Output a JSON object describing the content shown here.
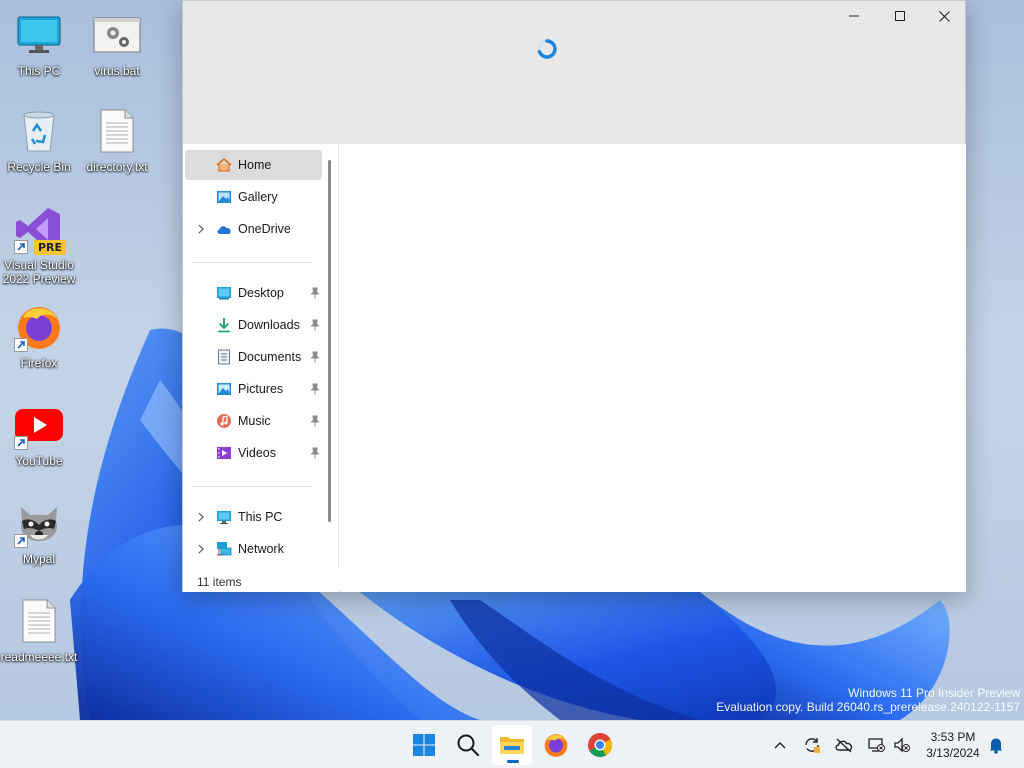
{
  "desktop": {
    "icons": [
      {
        "label": "This PC",
        "icon": "monitor-icon"
      },
      {
        "label": "virus.bat",
        "icon": "batch-file-icon"
      },
      {
        "label": "Recycle Bin",
        "icon": "recycle-bin-icon"
      },
      {
        "label": "directory.txt",
        "icon": "text-file-icon"
      },
      {
        "label": "Visual Studio\n2022 Preview",
        "icon": "visual-studio-icon",
        "badge": "PRE"
      },
      {
        "label": "Firefox",
        "icon": "firefox-icon"
      },
      {
        "label": "YouTube",
        "icon": "youtube-icon"
      },
      {
        "label": "Mypal",
        "icon": "raccoon-icon"
      },
      {
        "label": "readmeeee.txt",
        "icon": "text-file-icon"
      }
    ]
  },
  "explorer": {
    "nav": [
      {
        "label": "Home",
        "icon": "home-icon",
        "selected": true
      },
      {
        "label": "Gallery",
        "icon": "gallery-icon"
      },
      {
        "label": "OneDrive",
        "icon": "cloud-icon",
        "expandable": true
      },
      {
        "label": "Desktop",
        "icon": "desktop-icon",
        "pinned": true
      },
      {
        "label": "Downloads",
        "icon": "download-icon",
        "pinned": true
      },
      {
        "label": "Documents",
        "icon": "document-icon",
        "pinned": true
      },
      {
        "label": "Pictures",
        "icon": "pictures-icon",
        "pinned": true
      },
      {
        "label": "Music",
        "icon": "music-icon",
        "pinned": true
      },
      {
        "label": "Videos",
        "icon": "video-icon",
        "pinned": true
      },
      {
        "label": "This PC",
        "icon": "pc-icon",
        "expandable": true
      },
      {
        "label": "Network",
        "icon": "network-icon",
        "expandable": true
      }
    ],
    "status": "11 items"
  },
  "watermark": {
    "line1": "Windows 11 Pro Insider Preview",
    "line2": "Evaluation copy. Build 26040.rs_prerelease.240122-1157"
  },
  "taskbar": {
    "apps": [
      "start-icon",
      "search-icon",
      "file-explorer-icon",
      "firefox-icon",
      "chrome-icon"
    ],
    "tray": [
      "chevron-up-icon",
      "sync-icon",
      "onedrive-offline-icon",
      "network-disconnected-icon",
      "volume-muted-icon"
    ],
    "time": "3:53 PM",
    "date": "3/13/2024"
  },
  "colors": {
    "accent": "#0067c0",
    "wallpaper": "#2a64e0"
  }
}
